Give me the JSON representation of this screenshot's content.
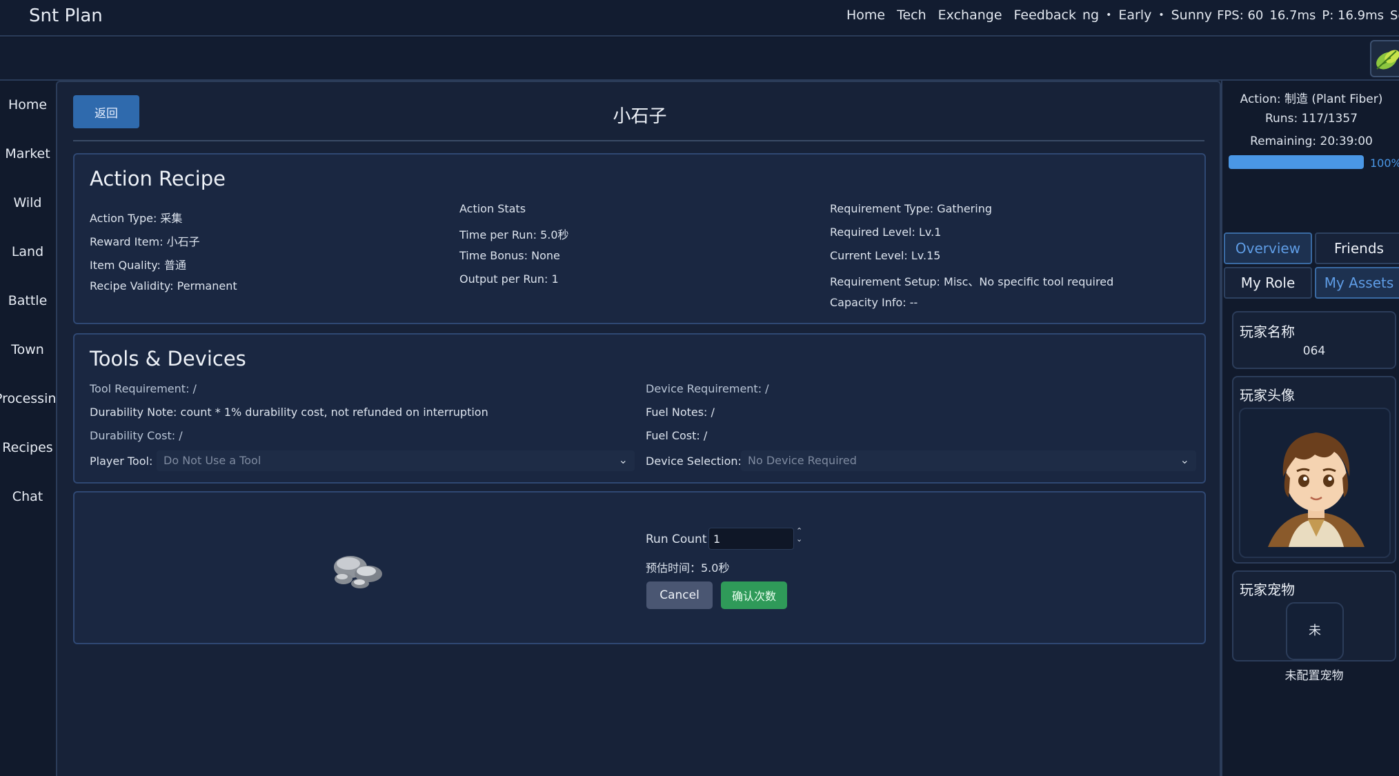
{
  "app": {
    "brand": "Snt Plan"
  },
  "topnav": {
    "links": [
      "Home",
      "Tech",
      "Exchange",
      "Feedback"
    ],
    "season_partial": "ng",
    "phase": "Early",
    "weather": "Sunny",
    "fps": "FPS: 60",
    "frame_ms": "16.7ms",
    "p_ms": "P: 16.9ms",
    "settings_partial": "Setting",
    "separator": "•"
  },
  "leftnav": [
    "Home",
    "Market",
    "Wild",
    "Land",
    "Battle",
    "Town",
    "Processing",
    "Recipes",
    "Chat"
  ],
  "main": {
    "back_label": "返回",
    "title": "小石子",
    "recipe": {
      "heading": "Action Recipe",
      "col1": [
        "Action Type: 采集",
        "Reward Item: 小石子",
        "Item Quality: 普通",
        "Recipe Validity: Permanent"
      ],
      "col2": [
        "Action Stats",
        "Time per Run: 5.0秒",
        "Time Bonus: None",
        "Output per Run: 1"
      ],
      "col3": [
        "Requirement Type: Gathering",
        "Required Level: Lv.1",
        "Current Level: Lv.15",
        "Requirement Setup: Misc、No specific tool required",
        "Capacity Info: --"
      ]
    },
    "tools": {
      "heading": "Tools & Devices",
      "tool_requirement": "Tool Requirement: /",
      "durability_note": "Durability Note: count * 1% durability cost, not refunded on interruption",
      "durability_cost": "Durability Cost: /",
      "device_requirement": "Device Requirement: /",
      "fuel_notes": "Fuel Notes: /",
      "fuel_cost": "Fuel Cost: /",
      "player_tool_label": "Player Tool:",
      "player_tool_value": "Do Not Use a Tool",
      "device_selection_label": "Device Selection:",
      "device_selection_value": "No Device Required"
    },
    "run": {
      "run_count_label": "Run Count",
      "run_count_value": "1",
      "estimated_time": "预估时间：5.0秒",
      "cancel_label": "Cancel",
      "confirm_label": "确认次数",
      "item_icon": "stones-icon"
    }
  },
  "rightpanel": {
    "action": "Action: 制造 (Plant Fiber)",
    "runs": "Runs: 117/1357",
    "remaining": "Remaining: 20:39:00",
    "progress_percent": 100,
    "progress_label": "100%",
    "tabs": [
      "Overview",
      "Friends",
      "My Role",
      "My Assets"
    ],
    "player_name_title": "玩家名称",
    "player_name_value": "064",
    "player_avatar_title": "玩家头像",
    "player_pet_title": "玩家宠物",
    "pet_placeholder": "未",
    "pet_status": "未配置宠物"
  },
  "colors": {
    "background": "#111a2c",
    "accent": "#4a97e6",
    "primary_button": "#2f6aad",
    "confirm_button": "#2f9a59",
    "cancel_button": "#4a5672"
  }
}
